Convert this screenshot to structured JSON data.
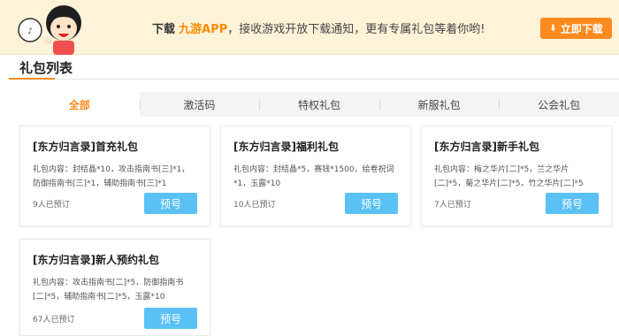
{
  "banner": {
    "download_label": "下载",
    "app_name": "九游APP",
    "message": "，接收游戏开放下载通知，更有专属礼包等着你哟!",
    "button_label": "立即下载",
    "colors": {
      "accent": "#ff8a1e",
      "background": "#fdf3d8"
    }
  },
  "section": {
    "title": "礼包列表"
  },
  "tabs": [
    {
      "label": "全部",
      "active": true
    },
    {
      "label": "激活码",
      "active": false
    },
    {
      "label": "特权礼包",
      "active": false
    },
    {
      "label": "新服礼包",
      "active": false
    },
    {
      "label": "公会礼包",
      "active": false
    }
  ],
  "cards": [
    {
      "title": "[东方归言录]首充礼包",
      "content": "礼包内容：封结晶*10，攻击指南书[三]*1，防御指南书[三]*1，辅助指南书[三]*1",
      "count": "9人已预订",
      "button": "预号"
    },
    {
      "title": "[东方归言录]福利礼包",
      "content": "礼包内容：封结晶*5，赛钱*1500，绘卷祝词*1，玉露*10",
      "count": "10人已预订",
      "button": "预号"
    },
    {
      "title": "[东方归言录]新手礼包",
      "content": "礼包内容：梅之华片[二]*5，兰之华片[二]*5，菊之华片[二]*5，竹之华片[二]*5",
      "count": "7人已预订",
      "button": "预号"
    },
    {
      "title": "[东方归言录]新人预约礼包",
      "content": "礼包内容：攻击指南书[二]*5，防御指南书[二]*5，辅助指南书[二]*5，玉露*10",
      "count": "67人已预订",
      "button": "预号"
    }
  ],
  "colors": {
    "reserve_button": "#5ac1f5",
    "active_tab": "#ff8a1e"
  }
}
